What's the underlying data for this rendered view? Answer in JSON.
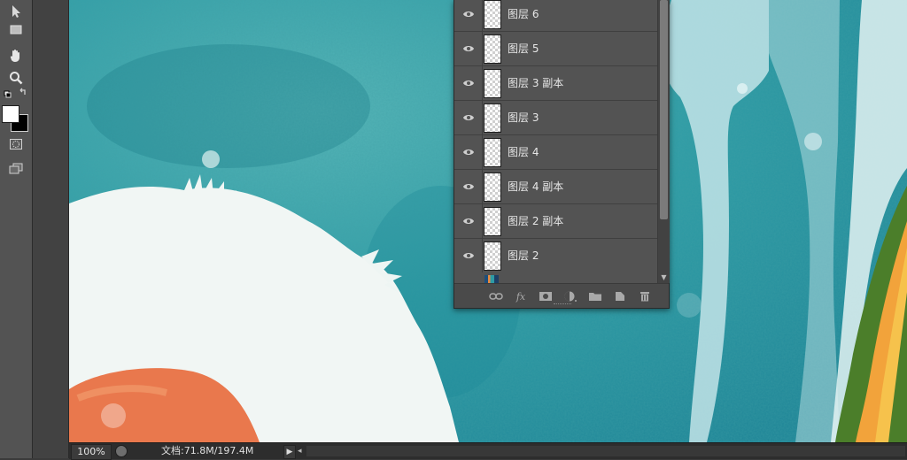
{
  "layers_panel": {
    "layers": [
      {
        "name": "图层 6"
      },
      {
        "name": "图层 5"
      },
      {
        "name": "图层 3 副本"
      },
      {
        "name": "图层 3"
      },
      {
        "name": "图层 4"
      },
      {
        "name": "图层 4 副本"
      },
      {
        "name": "图层 2 副本"
      },
      {
        "name": "图层 2"
      }
    ],
    "footer_icons": [
      "link-icon",
      "fx-icon",
      "mask-icon",
      "adjustment-icon",
      "folder-icon",
      "new-layer-icon",
      "trash-icon"
    ],
    "fx_label": "fx"
  },
  "status_bar": {
    "zoom": "100%",
    "doc_info": "文档:71.8M/197.4M"
  },
  "toolbar": {
    "tools": [
      "move-tool-icon",
      "marquee-tool-icon",
      "hand-tool-icon",
      "zoom-tool-icon",
      "swap-colors-icon",
      "color-swatch",
      "quick-mask-icon",
      "screen-mode-icon"
    ]
  },
  "colors": {
    "canvas_teal": "#2e9aa4",
    "panel_bg": "#535353",
    "foreground_color": "#ffffff",
    "background_color": "#000000"
  }
}
